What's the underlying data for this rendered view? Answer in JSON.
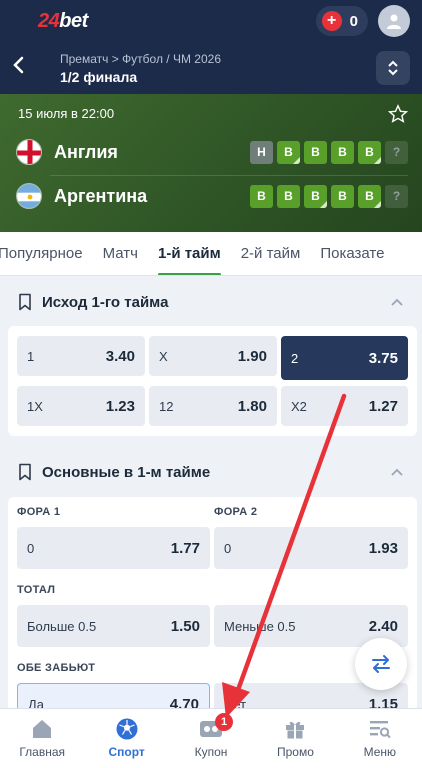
{
  "brand": {
    "logo_num": "24",
    "logo_txt": "bet"
  },
  "header": {
    "balance": "0"
  },
  "nav": {
    "breadcrumb": "Прематч > Футбол / ЧМ 2026",
    "title": "1/2 финала"
  },
  "match": {
    "date": "15 июля в 22:00",
    "team1": {
      "name": "Англия",
      "form": [
        "Н",
        "В",
        "В",
        "В",
        "В",
        "?"
      ]
    },
    "team2": {
      "name": "Аргентина",
      "form": [
        "В",
        "В",
        "В",
        "В",
        "В",
        "?"
      ]
    }
  },
  "tabs": [
    "Популярное",
    "Матч",
    "1-й тайм",
    "2-й тайм",
    "Показате"
  ],
  "section1": {
    "title": "Исход 1-го тайма",
    "odds": [
      {
        "label": "1",
        "value": "3.40"
      },
      {
        "label": "X",
        "value": "1.90"
      },
      {
        "label": "2",
        "value": "3.75"
      },
      {
        "label": "1X",
        "value": "1.23"
      },
      {
        "label": "12",
        "value": "1.80"
      },
      {
        "label": "X2",
        "value": "1.27"
      }
    ]
  },
  "section2": {
    "title": "Основные в 1-м тайме",
    "fora1": {
      "label": "ФОРА 1",
      "name": "0",
      "value": "1.77"
    },
    "fora2": {
      "label": "ФОРА 2",
      "name": "0",
      "value": "1.93"
    },
    "total": {
      "label": "ТОТАЛ",
      "over": {
        "name": "Больше 0.5",
        "value": "1.50"
      },
      "under": {
        "name": "Меньше 0.5",
        "value": "2.40"
      }
    },
    "both": {
      "label": "ОБЕ ЗАБЬЮТ",
      "yes": {
        "name": "Да",
        "value": "4.70"
      },
      "no": {
        "name": "Нет",
        "value": "1.15"
      }
    }
  },
  "bottom_nav": {
    "items": [
      "Главная",
      "Спорт",
      "Купон",
      "Промо",
      "Меню"
    ],
    "coupon_badge": "1"
  },
  "colors": {
    "header_bg": "#1d2b4a",
    "accent_green": "#3aa04a",
    "selected_odd": "#26385c",
    "badge_red": "#e8323a",
    "arrow_red": "#e8323a"
  }
}
